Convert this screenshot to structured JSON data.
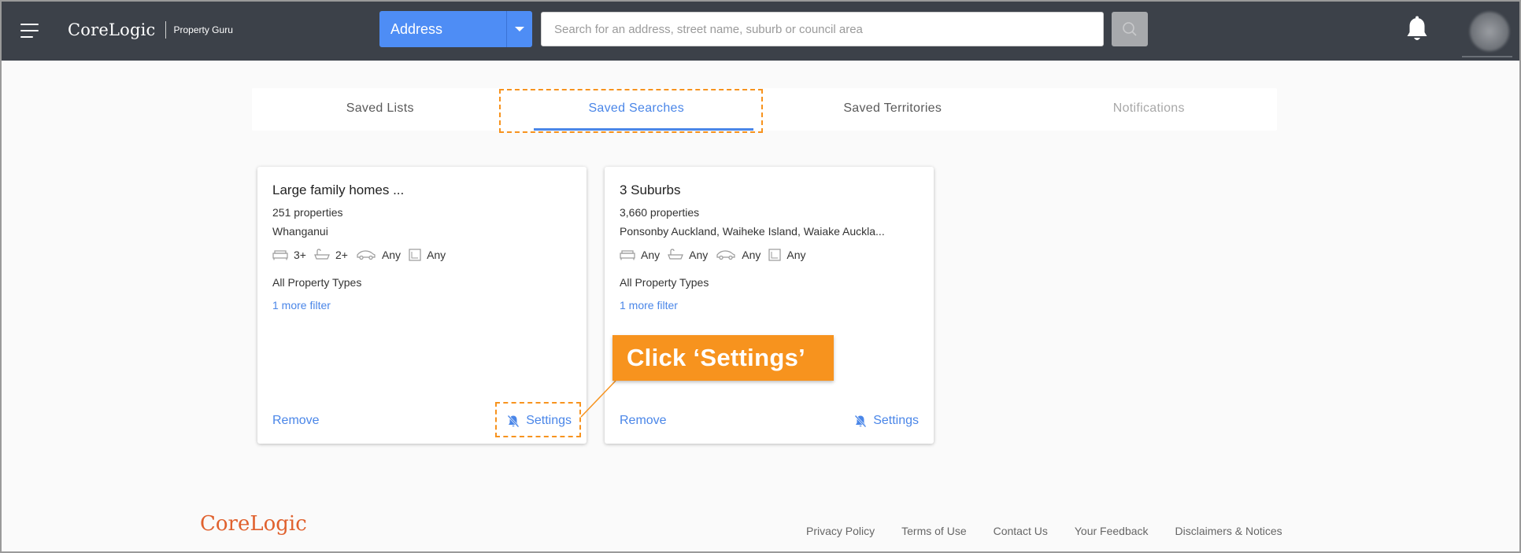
{
  "header": {
    "brand_logo": "CoreLogic",
    "brand_sub": "Property Guru",
    "search_type": "Address",
    "search_placeholder": "Search for an address, street name, suburb or council area",
    "icons": [
      "menu-icon",
      "caret-down-icon",
      "search-icon",
      "bell-icon",
      "avatar"
    ]
  },
  "tabs": [
    {
      "label": "Saved Lists",
      "state": "normal"
    },
    {
      "label": "Saved Searches",
      "state": "active"
    },
    {
      "label": "Saved Territories",
      "state": "normal"
    },
    {
      "label": "Notifications",
      "state": "disabled"
    }
  ],
  "cards": [
    {
      "title": "Large family homes ...",
      "count": "251 properties",
      "location": "Whanganui",
      "beds": "3+",
      "baths": "2+",
      "cars": "Any",
      "land": "Any",
      "types": "All Property Types",
      "more": "1 more filter",
      "remove": "Remove",
      "settings": "Settings"
    },
    {
      "title": "3 Suburbs",
      "count": "3,660 properties",
      "location": "Ponsonby Auckland, Waiheke Island, Waiake Auckla...",
      "beds": "Any",
      "baths": "Any",
      "cars": "Any",
      "land": "Any",
      "types": "All Property Types",
      "more": "1 more filter",
      "remove": "Remove",
      "settings": "Settings"
    }
  ],
  "callout": {
    "text": "Click ‘Settings’"
  },
  "footer": {
    "logo": "CoreLogic",
    "links": [
      "Privacy Policy",
      "Terms of Use",
      "Contact Us",
      "Your Feedback",
      "Disclaimers & Notices"
    ]
  },
  "colors": {
    "header_bg": "#3c4149",
    "accent_blue": "#4a86e8",
    "callout_orange": "#f7931e",
    "footer_logo": "#e0612e"
  }
}
